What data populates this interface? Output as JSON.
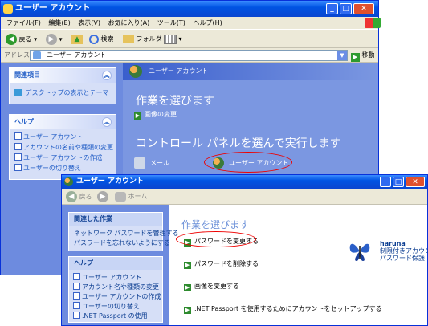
{
  "win1": {
    "title": "ユーザー アカウント",
    "menu": [
      "ファイル(F)",
      "編集(E)",
      "表示(V)",
      "お気に入り(A)",
      "ツール(T)",
      "ヘルプ(H)"
    ],
    "toolbar": {
      "back": "戻る",
      "search": "検索",
      "folders": "フォルダ"
    },
    "address": {
      "label": "アドレス(D)",
      "value": "ユーザー アカウント",
      "go": "移動"
    },
    "related": {
      "title": "関連項目",
      "items": [
        "デスクトップの表示とテーマ"
      ]
    },
    "help": {
      "title": "ヘルプ",
      "items": [
        "ユーザー アカウント",
        "アカウントの名前や種類の変更",
        "ユーザー アカウントの作成",
        "ユーザーの切り替え"
      ]
    },
    "main": {
      "heading": "作業を選びます",
      "task": "画像の変更",
      "heading2": "コントロール パネルを選んで実行します",
      "icons": [
        "メール",
        "ユーザー アカウント"
      ]
    }
  },
  "win2": {
    "title": "ユーザー アカウント",
    "nav": {
      "back": "戻る",
      "home": "ホーム"
    },
    "related": {
      "title": "関連した作業",
      "items": [
        "ネットワーク パスワードを管理する",
        "パスワードを忘れないようにする"
      ]
    },
    "help": {
      "title": "ヘルプ",
      "items": [
        "ユーザー アカウント",
        "アカウント名や種類の変更",
        "ユーザー アカウントの作成",
        "ユーザーの切り替え",
        ".NET Passport の使用"
      ]
    },
    "main": {
      "heading": "作業を選びます",
      "tasks": [
        "パスワードを変更する",
        "パスワードを削除する",
        "画像を変更する",
        ".NET Passport を使用するためにアカウントをセットアップする"
      ]
    },
    "user": {
      "name": "haruna",
      "line1": "制限付きアカウント",
      "line2": "パスワード保護"
    }
  }
}
